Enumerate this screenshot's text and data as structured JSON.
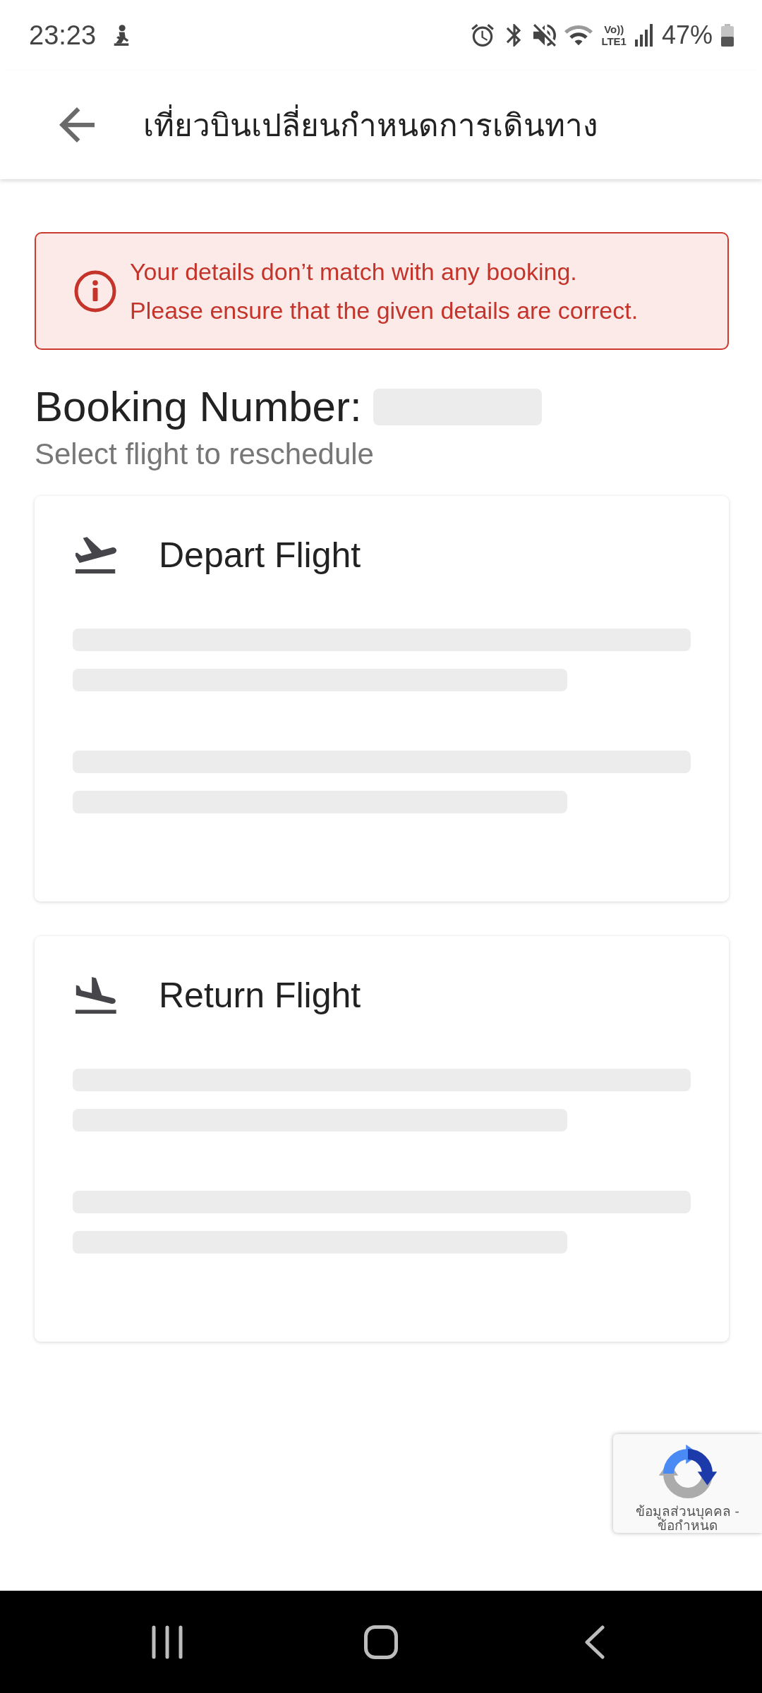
{
  "status_bar": {
    "time": "23:23",
    "network_labels": [
      "Vo))",
      "LTE1"
    ],
    "battery": "47%"
  },
  "app_bar": {
    "title": "เที่ยวบินเปลี่ยนกำหนดการเดินทาง"
  },
  "error_banner": {
    "lines": [
      "Your details don’t match with any booking.",
      "Please ensure that the given details are correct."
    ]
  },
  "booking": {
    "label": "Booking Number:",
    "loading": true,
    "hint": "Select flight to reschedule"
  },
  "flights": [
    {
      "kind": "depart",
      "title": "Depart Flight",
      "loading": true
    },
    {
      "kind": "return",
      "title": "Return Flight",
      "loading": true
    }
  ],
  "recaptcha": {
    "links": [
      "ข้อมูลส่วนบุคคล",
      "ข้อกำหนด"
    ],
    "separator": "-"
  }
}
